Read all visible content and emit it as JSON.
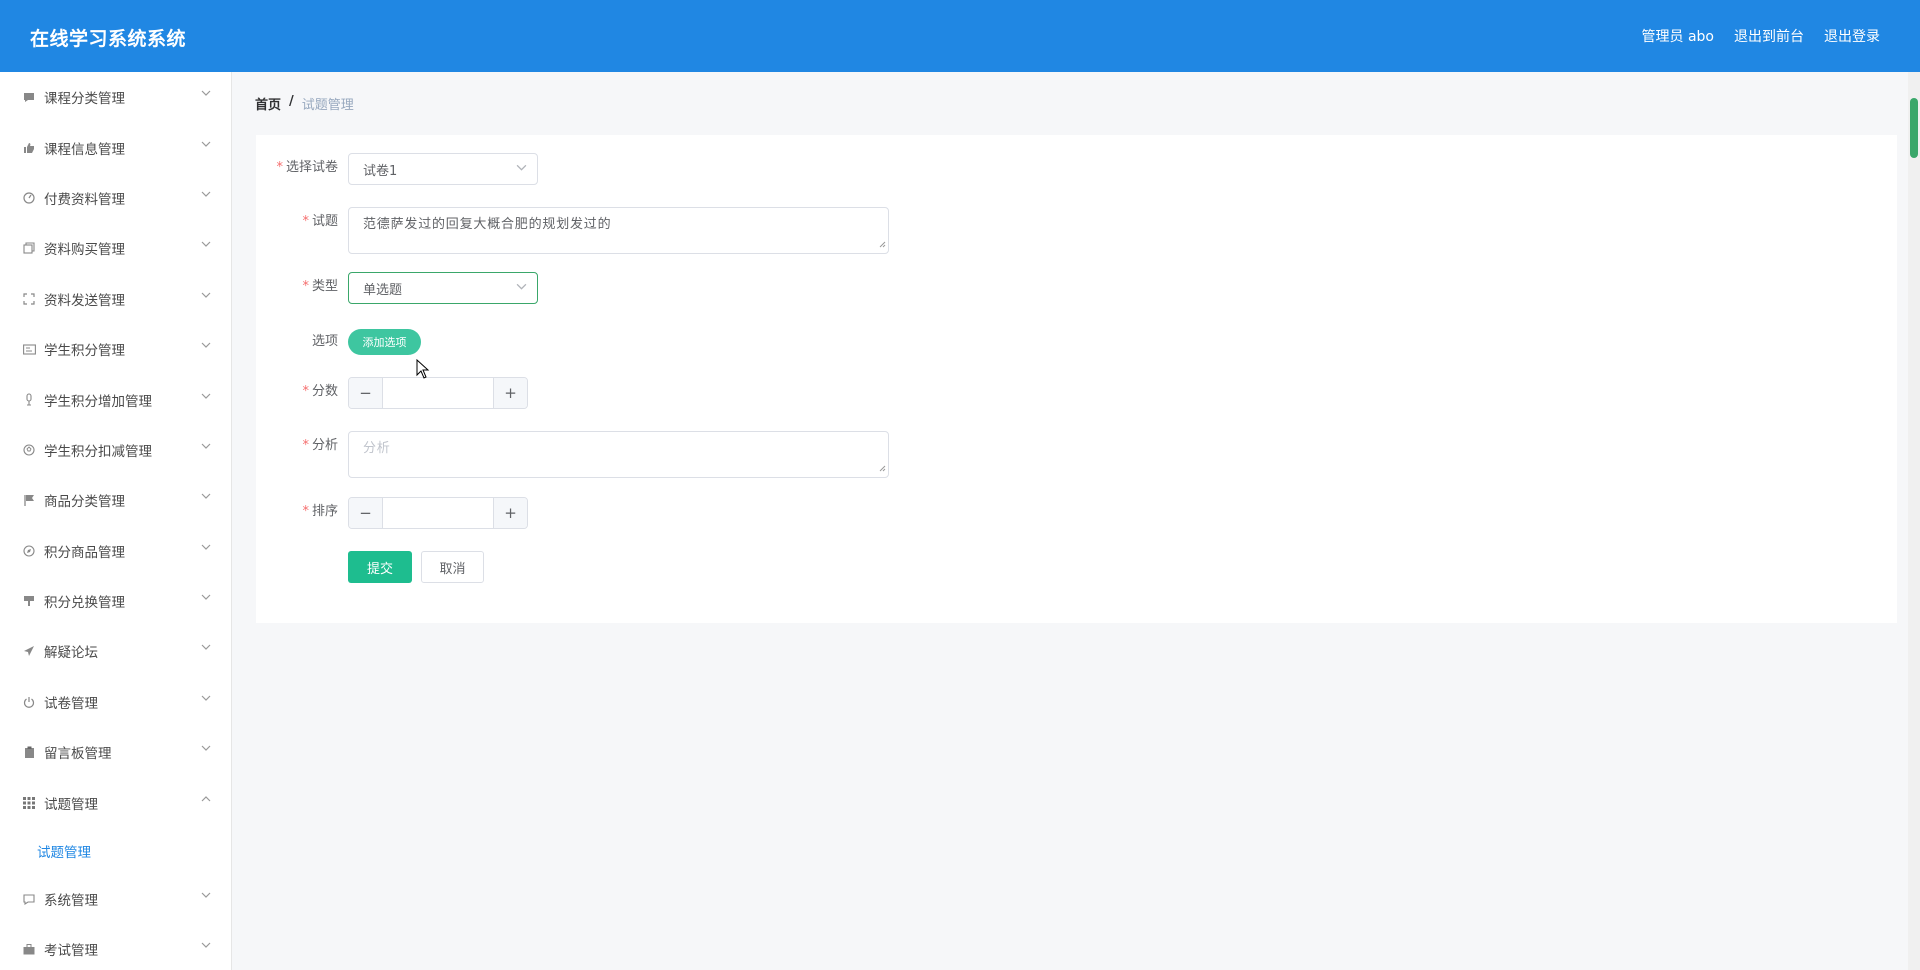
{
  "header": {
    "title": "在线学习系统系统",
    "admin": "管理员 abo",
    "to_front": "退出到前台",
    "logout": "退出登录"
  },
  "sidebar": {
    "items": [
      {
        "label": "课程分类管理",
        "icon": "comment-icon"
      },
      {
        "label": "课程信息管理",
        "icon": "thumbs-up-icon"
      },
      {
        "label": "付费资料管理",
        "icon": "dashboard-icon"
      },
      {
        "label": "资料购买管理",
        "icon": "copy-icon"
      },
      {
        "label": "资料发送管理",
        "icon": "fullscreen-icon"
      },
      {
        "label": "学生积分管理",
        "icon": "id-card-icon"
      },
      {
        "label": "学生积分增加管理",
        "icon": "microphone-icon"
      },
      {
        "label": "学生积分扣减管理",
        "icon": "soccer-ball-icon"
      },
      {
        "label": "商品分类管理",
        "icon": "flag-icon"
      },
      {
        "label": "积分商品管理",
        "icon": "compass-icon"
      },
      {
        "label": "积分兑换管理",
        "icon": "paint-brush-icon"
      },
      {
        "label": "解疑论坛",
        "icon": "paper-plane-icon"
      },
      {
        "label": "试卷管理",
        "icon": "power-icon"
      },
      {
        "label": "留言板管理",
        "icon": "clipboard-icon"
      },
      {
        "label": "试题管理",
        "icon": "grid-icon"
      },
      {
        "label": "系统管理",
        "icon": "message-icon"
      },
      {
        "label": "考试管理",
        "icon": "briefcase-icon"
      }
    ],
    "sub_item": "试题管理"
  },
  "breadcrumb": {
    "home": "首页",
    "separator": "/",
    "current": "试题管理"
  },
  "form": {
    "paper_label": "选择试卷",
    "paper_value": "试卷1",
    "question_label": "试题",
    "question_value": "范德萨发过的回复大概合肥的规划发过的",
    "type_label": "类型",
    "type_value": "单选题",
    "options_label": "选项",
    "add_option": "添加选项",
    "score_label": "分数",
    "analysis_label": "分析",
    "analysis_placeholder": "分析",
    "order_label": "排序",
    "submit": "提交",
    "cancel": "取消",
    "required_mark": "*"
  },
  "colors": {
    "header_bg": "#2087e3",
    "accent_green": "#1ebd8f",
    "required": "#f56c6c"
  }
}
